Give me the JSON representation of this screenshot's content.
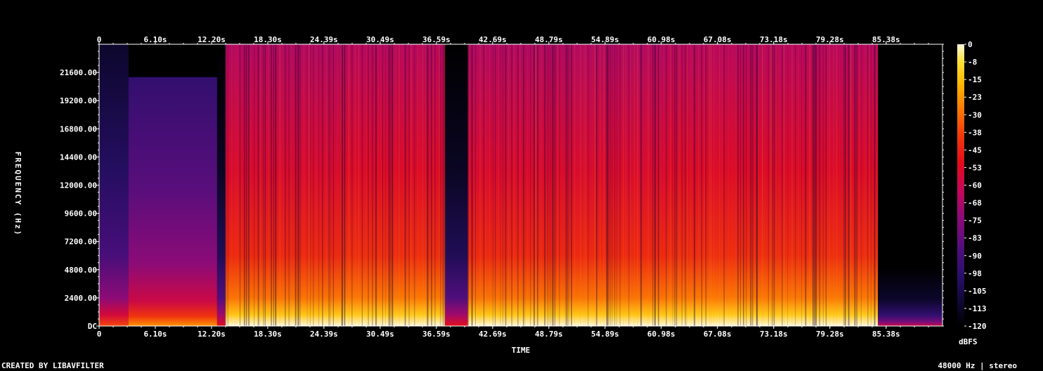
{
  "chart_data": {
    "type": "heatmap",
    "title": "",
    "xlabel": "TIME",
    "ylabel": "FREQUENCY (Hz)",
    "x_ticks": [
      "0",
      "6.10s",
      "12.20s",
      "18.30s",
      "24.39s",
      "30.49s",
      "36.59s",
      "42.69s",
      "48.79s",
      "54.89s",
      "60.98s",
      "67.08s",
      "73.18s",
      "79.28s",
      "85.38s"
    ],
    "x_tick_seconds": [
      0,
      6.1,
      12.2,
      18.3,
      24.39,
      30.49,
      36.59,
      42.69,
      48.79,
      54.89,
      60.98,
      67.08,
      73.18,
      79.28,
      85.38
    ],
    "x_range_seconds": [
      0,
      91.5
    ],
    "y_ticks": [
      "DC",
      "2400.00",
      "4800.00",
      "7200.00",
      "9600.00",
      "12000.00",
      "14400.00",
      "16800.00",
      "19200.00",
      "21600.00"
    ],
    "y_tick_hz": [
      0,
      2400,
      4800,
      7200,
      9600,
      12000,
      14400,
      16800,
      19200,
      21600
    ],
    "y_range_hz": [
      0,
      24000
    ],
    "colorbar": {
      "label": "dBFS",
      "ticks": [
        "0",
        "-8",
        "-15",
        "-23",
        "-30",
        "-38",
        "-45",
        "-53",
        "-60",
        "-68",
        "-75",
        "-83",
        "-90",
        "-98",
        "-105",
        "-113",
        "-120"
      ],
      "range_db": [
        -120,
        0
      ],
      "colors": [
        "#000000",
        "#0d0830",
        "#2a0f6b",
        "#520e7d",
        "#8a0b78",
        "#c0085a",
        "#e30c1a",
        "#f23d0b",
        "#fb7a05",
        "#ffb703",
        "#ffe23a",
        "#fffbe0"
      ]
    },
    "segments": [
      {
        "start_s": 0.0,
        "end_s": 3.2,
        "level_db": -100,
        "cutoff_hz": 24000
      },
      {
        "start_s": 3.2,
        "end_s": 12.8,
        "level_db": -86,
        "cutoff_hz": 21200
      },
      {
        "start_s": 12.8,
        "end_s": 13.7,
        "level_db": -112,
        "cutoff_hz": 24000
      },
      {
        "start_s": 13.7,
        "end_s": 26.3,
        "level_db": -58,
        "cutoff_hz": 24000
      },
      {
        "start_s": 26.3,
        "end_s": 37.5,
        "level_db": -57,
        "cutoff_hz": 24000
      },
      {
        "start_s": 37.5,
        "end_s": 40.0,
        "level_db": -112,
        "cutoff_hz": 24000
      },
      {
        "start_s": 40.0,
        "end_s": 61.5,
        "level_db": -58,
        "cutoff_hz": 24000
      },
      {
        "start_s": 61.5,
        "end_s": 84.5,
        "level_db": -57,
        "cutoff_hz": 24000
      },
      {
        "start_s": 84.5,
        "end_s": 91.5,
        "level_db": -120,
        "cutoff_hz": 9000
      }
    ]
  },
  "footer": {
    "left": "CREATED BY LIBAVFILTER",
    "right": "48000 Hz | stereo"
  }
}
